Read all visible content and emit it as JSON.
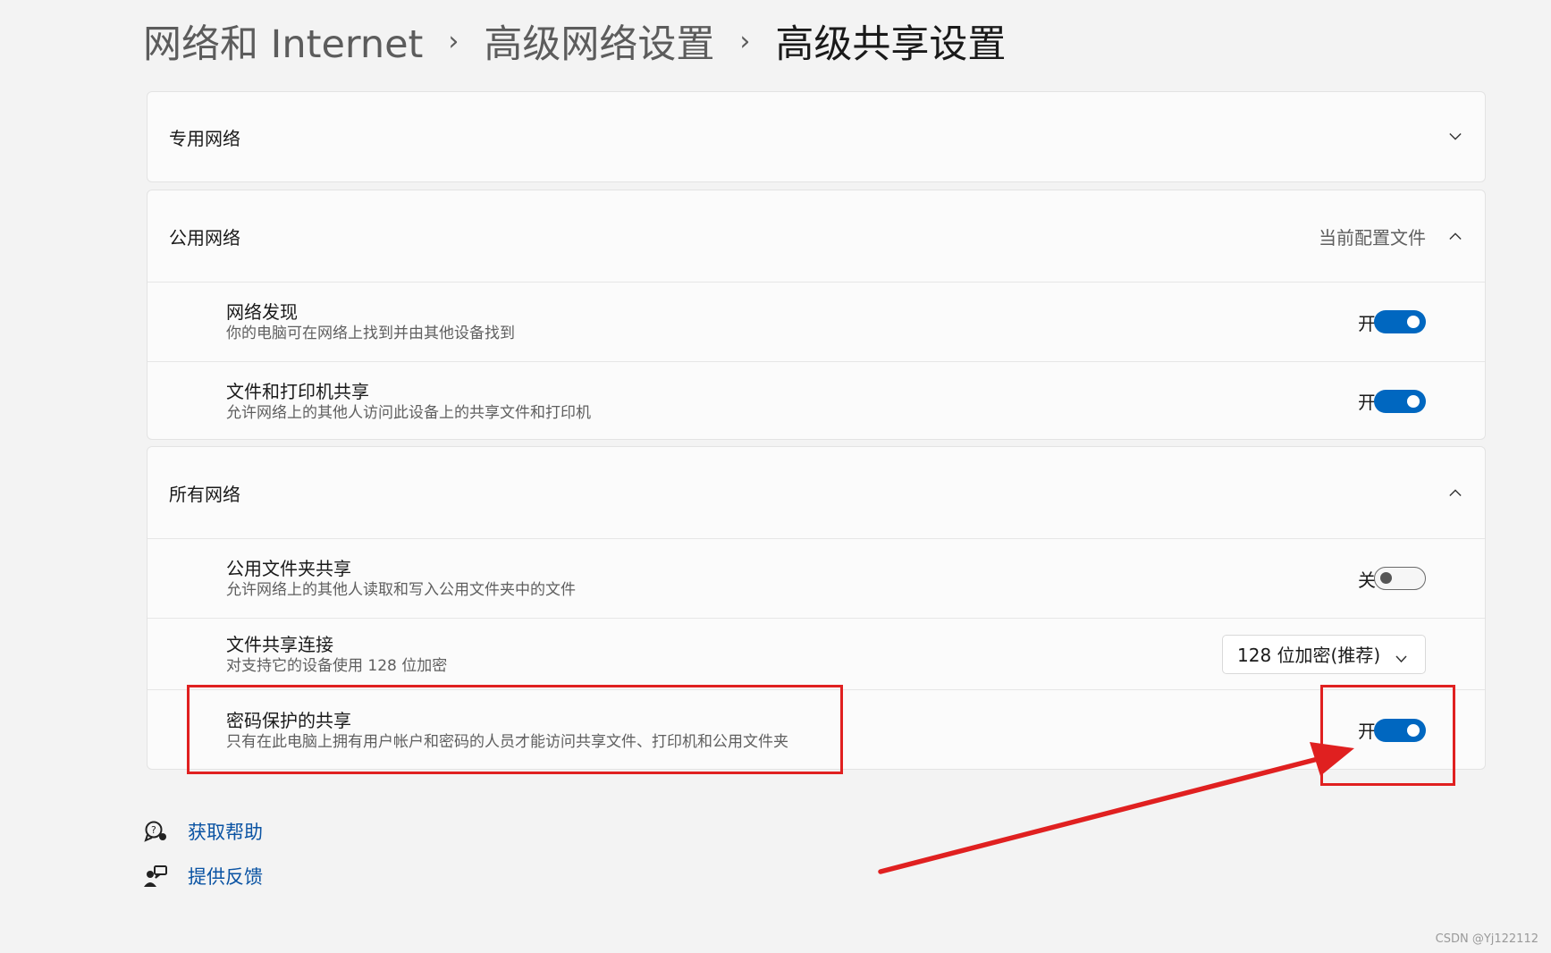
{
  "breadcrumb": {
    "items": [
      "网络和 Internet",
      "高级网络设置",
      "高级共享设置"
    ]
  },
  "sections": {
    "private": {
      "title": "专用网络"
    },
    "public": {
      "title": "公用网络",
      "profile_label": "当前配置文件",
      "items": [
        {
          "title": "网络发现",
          "desc": "你的电脑可在网络上找到并由其他设备找到",
          "state": "开",
          "on": true
        },
        {
          "title": "文件和打印机共享",
          "desc": "允许网络上的其他人访问此设备上的共享文件和打印机",
          "state": "开",
          "on": true
        }
      ]
    },
    "all": {
      "title": "所有网络",
      "items": [
        {
          "title": "公用文件夹共享",
          "desc": "允许网络上的其他人读取和写入公用文件夹中的文件",
          "state": "关",
          "on": false
        },
        {
          "title": "文件共享连接",
          "desc": "对支持它的设备使用 128 位加密",
          "dropdown_value": "128 位加密(推荐)"
        },
        {
          "title": "密码保护的共享",
          "desc": "只有在此电脑上拥有用户帐户和密码的人员才能访问共享文件、打印机和公用文件夹",
          "state": "开",
          "on": true
        }
      ]
    }
  },
  "links": {
    "help": {
      "label": "获取帮助",
      "icon": "help-chat-icon"
    },
    "feedback": {
      "label": "提供反馈",
      "icon": "feedback-person-icon"
    }
  },
  "colors": {
    "accent": "#0067c0",
    "annotation": "#e02020",
    "link": "#0a53a3"
  },
  "watermark": "CSDN @Yj122112"
}
